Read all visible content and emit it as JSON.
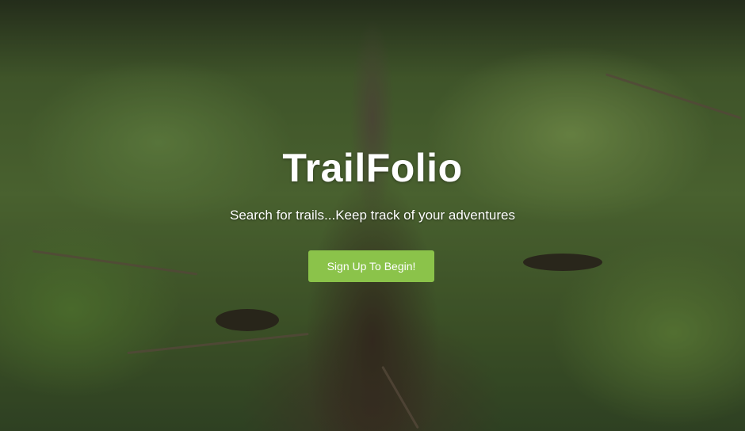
{
  "hero": {
    "title": "TrailFolio",
    "subtitle": "Search for trails...Keep track of your adventures",
    "cta_label": "Sign Up To Begin!"
  },
  "colors": {
    "cta_background": "#8bc34a",
    "text": "#ffffff"
  }
}
